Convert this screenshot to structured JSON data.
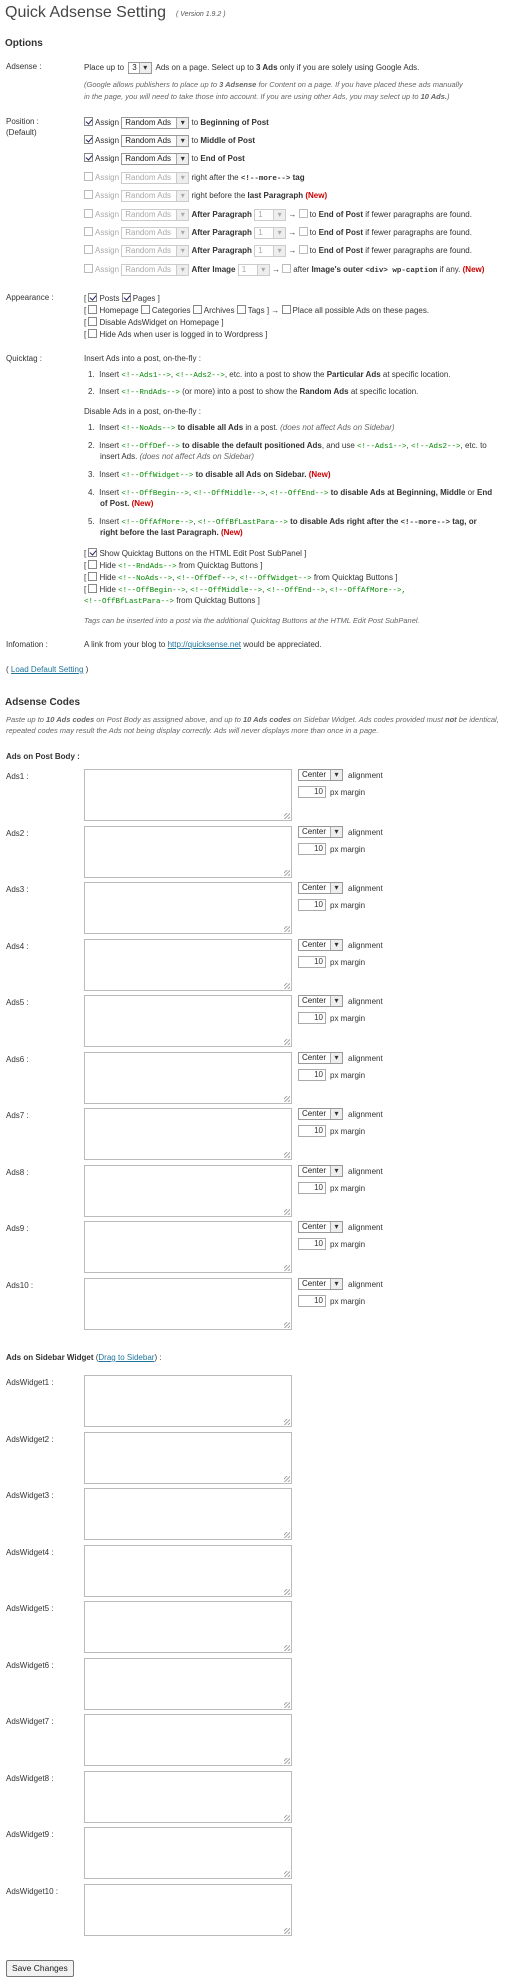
{
  "title": "Quick Adsense Setting",
  "version": "( Version 1.9.2 )",
  "options_heading": "Options",
  "adsense": {
    "label": "Adsense :",
    "pre": "Place up to",
    "count": "3",
    "post": "Ads on a page. Select up to",
    "post_b": "3 Ads",
    "post2": "only if you are solely using Google Ads.",
    "note1": "(Google allows publishers to place up to",
    "note1_b": "3 Adsense",
    "note1_rest": "for Content on a page. If you have placed these ads manually",
    "note2": "in the page, you will need to take those into account. If you are using other Ads, you may select up to",
    "note2_b": "10 Ads.",
    "note2_end": ")"
  },
  "position": {
    "label": "Position :",
    "label2": "(Default)",
    "rows": [
      {
        "checked": true,
        "assign": "Assign",
        "sel": "Random Ads",
        "to": "to",
        "target": "Beginning of Post"
      },
      {
        "checked": true,
        "assign": "Assign",
        "sel": "Random Ads",
        "to": "to",
        "target": "Middle of Post"
      },
      {
        "checked": true,
        "assign": "Assign",
        "sel": "Random Ads",
        "to": "to",
        "target": "End of Post"
      }
    ],
    "more_tag": {
      "assign": "Assign",
      "sel": "Random Ads",
      "pre": "right after the",
      "tag": "<!--more-->",
      "post": "tag"
    },
    "last_para": {
      "assign": "Assign",
      "sel": "Random Ads",
      "pre": "right before the",
      "b": "last Paragraph",
      "new": "(New)"
    },
    "after_para": [
      {
        "assign": "Assign",
        "sel": "Random Ads",
        "b": "After Paragraph",
        "num": "1",
        "arrow": "→",
        "to": "to",
        "end": "End of Post",
        "rest": "if fewer paragraphs are found."
      },
      {
        "assign": "Assign",
        "sel": "Random Ads",
        "b": "After Paragraph",
        "num": "1",
        "arrow": "→",
        "to": "to",
        "end": "End of Post",
        "rest": "if fewer paragraphs are found."
      },
      {
        "assign": "Assign",
        "sel": "Random Ads",
        "b": "After Paragraph",
        "num": "1",
        "arrow": "→",
        "to": "to",
        "end": "End of Post",
        "rest": "if fewer paragraphs are found."
      }
    ],
    "after_image": {
      "assign": "Assign",
      "sel": "Random Ads",
      "b": "After Image",
      "num": "1",
      "arrow": "→",
      "pre": "after",
      "b2": "Image's outer",
      "code": "<div> wp-caption",
      "post": "if any.",
      "new": "(New)"
    }
  },
  "appearance": {
    "label": "Appearance :",
    "line1": {
      "open": "[",
      "posts": "Posts",
      "pages": "Pages",
      "close": "]"
    },
    "line2": {
      "open": "[",
      "homepage": "Homepage",
      "categories": "Categories",
      "archives": "Archives",
      "tags": "Tags",
      "close": "]",
      "arrow": "→",
      "place": "Place all possible Ads on these pages."
    },
    "line3": {
      "open": "[",
      "text": "Disable AdsWidget on Homepage",
      "close": "]"
    },
    "line4": {
      "open": "[",
      "text": "Hide Ads when user is logged in to Wordpress",
      "close": "]"
    }
  },
  "quicktag": {
    "label": "Quicktag :",
    "intro": "Insert Ads into a post, on-the-fly :",
    "i1_n": "1.",
    "i1_a": "Insert",
    "i1_c1": "<!--Ads1-->",
    "i1_c2": "<!--Ads2-->",
    "i1_rest": ", etc. into a post to show the",
    "i1_b": "Particular Ads",
    "i1_end": "at specific location.",
    "i2_n": "2.",
    "i2_a": "Insert",
    "i2_c": "<!--RndAds-->",
    "i2_rest": "(or more) into a post to show the",
    "i2_b": "Random Ads",
    "i2_end": "at specific location.",
    "intro2": "Disable Ads in a post, on-the-fly :",
    "d1_n": "1.",
    "d1_a": "Insert",
    "d1_c": "<!--NoAds-->",
    "d1_to": "to",
    "d1_b": "disable all Ads",
    "d1_in": "in a post.",
    "d1_note": "(does not affect Ads on Sidebar)",
    "d2_n": "2.",
    "d2_a": "Insert",
    "d2_c": "<!--OffDef-->",
    "d2_to": "to",
    "d2_b": "disable the default positioned Ads",
    "d2_rest": ", and use",
    "d2_c1": "<!--Ads1-->",
    "d2_c2": "<!--Ads2-->",
    "d2_etc": ", etc. to",
    "d2_l2": "insert Ads.",
    "d2_note": "(does not affect Ads on Sidebar)",
    "d3_n": "3.",
    "d3_a": "Insert",
    "d3_c": "<!--OffWidget-->",
    "d3_to": "to",
    "d3_b": "disable all Ads on Sidebar.",
    "d3_new": "(New)",
    "d4_n": "4.",
    "d4_a": "Insert",
    "d4_c1": "<!--OffBegin-->",
    "d4_c2": "<!--OffMiddle-->",
    "d4_c3": "<!--OffEnd-->",
    "d4_to": "to",
    "d4_b": "disable Ads at Beginning, Middle",
    "d4_or": "or",
    "d4_b2": "End",
    "d4_l2b": "of Post.",
    "d4_new": "(New)",
    "d5_n": "5.",
    "d5_a": "Insert",
    "d5_c1": "<!--OffAfMore-->",
    "d5_c2": "<!--OffBfLastPara-->",
    "d5_to": "to",
    "d5_b": "disable Ads right after the",
    "d5_c3": "<!--more-->",
    "d5_tag": "tag, or",
    "d5_l2b": "right before the last Paragraph.",
    "d5_new": "(New)",
    "show": "Show Quicktag Buttons on the HTML Edit Post SubPanel",
    "hide1_pre": "Hide",
    "hide1_c": "<!--RndAds-->",
    "hide1_post": "from Quicktag Buttons",
    "hide2_pre": "Hide",
    "hide2_c1": "<!--NoAds-->",
    "hide2_c2": "<!--OffDef-->",
    "hide2_c3": "<!--OffWidget-->",
    "hide2_post": "from Quicktag Buttons",
    "hide3_pre": "Hide",
    "hide3_c1": "<!--OffBegin-->",
    "hide3_c2": "<!--OffMiddle-->",
    "hide3_c3": "<!--OffEnd-->",
    "hide3_c4": "<!--OffAfMore-->,",
    "hide3_c5": "<!--OffBfLastPara-->",
    "hide3_post": "from Quicktag Buttons",
    "note": "Tags can be inserted into a post via the additional Quicktag Buttons at the HTML Edit Post SubPanel."
  },
  "information": {
    "label": "Infomation :",
    "pre": "A link from your blog to",
    "link": "http://quicksense.net",
    "post": "would be appreciated."
  },
  "load_default": {
    "open": "(",
    "link": "Load Default Setting",
    "close": ")"
  },
  "codes_heading": "Adsense Codes",
  "codes_note_1": "Paste up to",
  "codes_note_b1": "10 Ads codes",
  "codes_note_2": "on Post Body as assigned above, and up to",
  "codes_note_b2": "10 Ads codes",
  "codes_note_3": "on Sidebar Widget. Ads codes provided must",
  "codes_note_b3": "not",
  "codes_note_4": "be identical, repeated codes may result the Ads not being display correctly. Ads will never displays more than once in a page.",
  "post_body_heading": "Ads on Post Body :",
  "ads": [
    {
      "label": "Ads1 :",
      "align": "Center",
      "margin": "10"
    },
    {
      "label": "Ads2 :",
      "align": "Center",
      "margin": "10"
    },
    {
      "label": "Ads3 :",
      "align": "Center",
      "margin": "10"
    },
    {
      "label": "Ads4 :",
      "align": "Center",
      "margin": "10"
    },
    {
      "label": "Ads5 :",
      "align": "Center",
      "margin": "10"
    },
    {
      "label": "Ads6 :",
      "align": "Center",
      "margin": "10"
    },
    {
      "label": "Ads7 :",
      "align": "Center",
      "margin": "10"
    },
    {
      "label": "Ads8 :",
      "align": "Center",
      "margin": "10"
    },
    {
      "label": "Ads9 :",
      "align": "Center",
      "margin": "10"
    },
    {
      "label": "Ads10 :",
      "align": "Center",
      "margin": "10"
    }
  ],
  "alignment_label": "alignment",
  "margin_label": "px margin",
  "sidebar_heading": "Ads on Sidebar Widget",
  "sidebar_open": "(",
  "sidebar_link": "Drag to Sidebar",
  "sidebar_close": ") :",
  "widgets": [
    {
      "label": "AdsWidget1 :"
    },
    {
      "label": "AdsWidget2 :"
    },
    {
      "label": "AdsWidget3 :"
    },
    {
      "label": "AdsWidget4 :"
    },
    {
      "label": "AdsWidget5 :"
    },
    {
      "label": "AdsWidget6 :"
    },
    {
      "label": "AdsWidget7 :"
    },
    {
      "label": "AdsWidget8 :"
    },
    {
      "label": "AdsWidget9 :"
    },
    {
      "label": "AdsWidget10 :"
    }
  ],
  "save_button": "Save Changes"
}
